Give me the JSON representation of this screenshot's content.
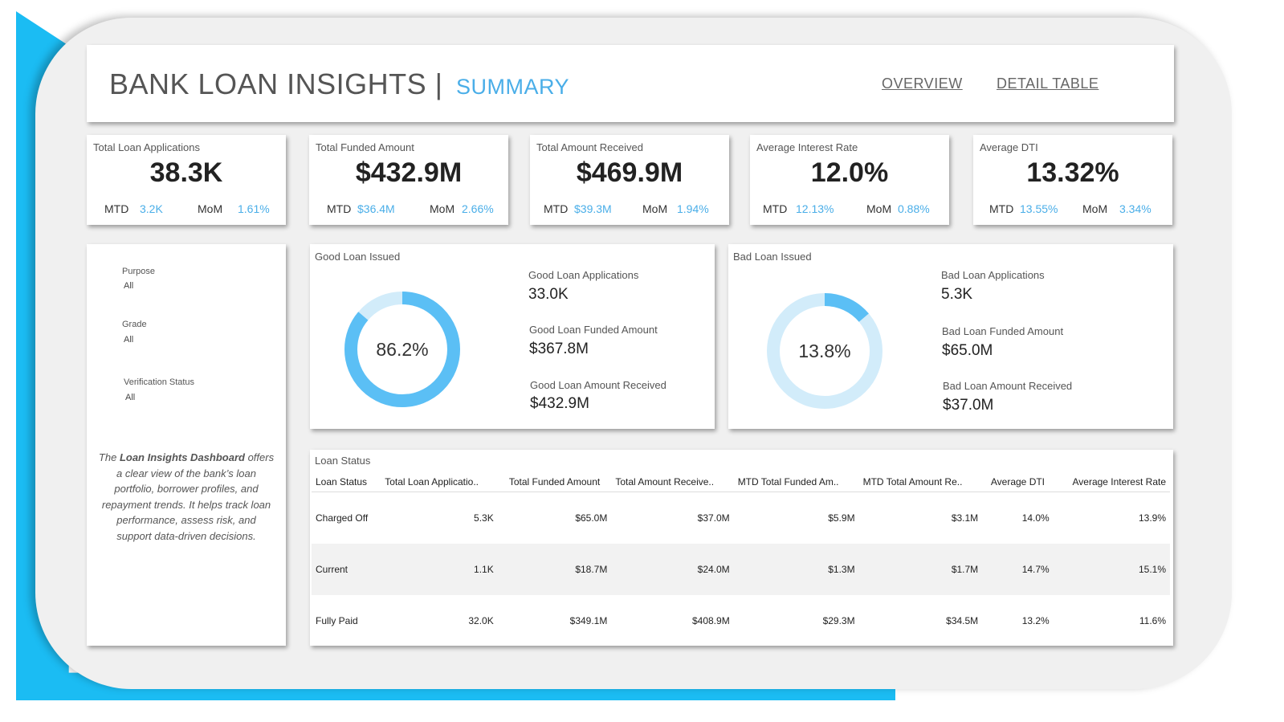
{
  "header": {
    "title": "BANK LOAN  INSIGHTS |",
    "subtitle": "SUMMARY",
    "nav": [
      "OVERVIEW",
      "DETAIL TABLE"
    ]
  },
  "kpis": [
    {
      "label": "Total Loan Applications",
      "value": "38.3K",
      "mtd_label": "MTD",
      "mtd": "3.2K",
      "mom_label": "MoM",
      "mom": "1.61%"
    },
    {
      "label": "Total Funded Amount",
      "value": "$432.9M",
      "mtd_label": "MTD",
      "mtd": "$36.4M",
      "mom_label": "MoM",
      "mom": "2.66%"
    },
    {
      "label": "Total Amount Received",
      "value": "$469.9M",
      "mtd_label": "MTD",
      "mtd": "$39.3M",
      "mom_label": "MoM",
      "mom": "1.94%"
    },
    {
      "label": "Average Interest Rate",
      "value": "12.0%",
      "mtd_label": "MTD",
      "mtd": "12.13%",
      "mom_label": "MoM",
      "mom": "0.88%"
    },
    {
      "label": "Average DTI",
      "value": "13.32%",
      "mtd_label": "MTD",
      "mtd": "13.55%",
      "mom_label": "MoM",
      "mom": "3.34%"
    }
  ],
  "filters": [
    {
      "label": "Purpose",
      "value": "All"
    },
    {
      "label": "Grade",
      "value": "All"
    },
    {
      "label": "Verification Status",
      "value": "All"
    }
  ],
  "description": {
    "pre": "The ",
    "bold": "Loan Insights Dashboard",
    "post": " offers a clear view of the bank’s loan portfolio, borrower profiles, and repayment trends. It helps track loan performance, assess risk, and support data-driven decisions."
  },
  "good_loan": {
    "title": "Good Loan Issued",
    "percent_label": "86.2%",
    "percent": 86.2,
    "metrics": [
      {
        "label": "Good Loan Applications",
        "value": "33.0K"
      },
      {
        "label": "Good Loan Funded Amount",
        "value": "$367.8M"
      },
      {
        "label": "Good Loan Amount Received",
        "value": "$432.9M"
      }
    ]
  },
  "bad_loan": {
    "title": "Bad Loan Issued",
    "percent_label": "13.8%",
    "percent": 13.8,
    "metrics": [
      {
        "label": "Bad Loan Applications",
        "value": "5.3K"
      },
      {
        "label": "Bad Loan Funded Amount",
        "value": "$65.0M"
      },
      {
        "label": "Bad Loan Amount Received",
        "value": "$37.0M"
      }
    ]
  },
  "colors": {
    "accent": "#1bbcf3",
    "donut_fill": "#5bbff5",
    "donut_track": "#d2ecfa",
    "highlight_text": "#4aaee8"
  },
  "loan_status": {
    "title": "Loan Status",
    "columns": [
      "Loan Status",
      "Total Loan Applicatio..",
      "Total Funded Amount",
      "Total Amount Receive..",
      "MTD Total Funded Am..",
      "MTD Total Amount Re..",
      "Average DTI",
      "Average Interest Rate"
    ],
    "rows": [
      [
        "Charged Off",
        "5.3K",
        "$65.0M",
        "$37.0M",
        "$5.9M",
        "$3.1M",
        "14.0%",
        "13.9%"
      ],
      [
        "Current",
        "1.1K",
        "$18.7M",
        "$24.0M",
        "$1.3M",
        "$1.7M",
        "14.7%",
        "15.1%"
      ],
      [
        "Fully Paid",
        "32.0K",
        "$349.1M",
        "$408.9M",
        "$29.3M",
        "$34.5M",
        "13.2%",
        "11.6%"
      ]
    ]
  }
}
